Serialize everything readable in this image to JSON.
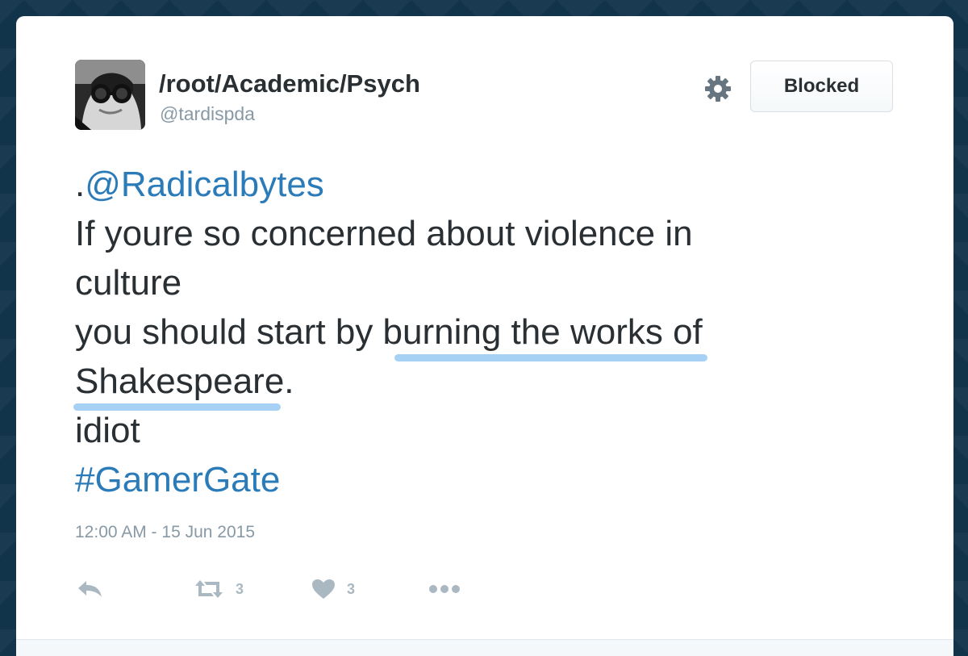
{
  "user": {
    "display_name": "/root/Academic/Psych",
    "handle": "@tardispda",
    "avatar": "avatar-photo"
  },
  "follow_button": {
    "label": "Blocked"
  },
  "tweet": {
    "prefix": ".",
    "mention": "@Radicalbytes",
    "line2": "If youre so concerned about violence in",
    "line3": "culture",
    "line4_before": "you should start by ",
    "line4_highlight": "burning the works of",
    "line5_highlight": "Shakespeare",
    "line5_after": ".",
    "line6": "idiot",
    "hashtag": "#GamerGate"
  },
  "timestamp": "12:00 AM - 15 Jun 2015",
  "actions": {
    "reply_icon": "reply-icon",
    "retweet_icon": "retweet-icon",
    "retweet_count": "3",
    "like_icon": "heart-icon",
    "like_count": "3",
    "more_icon": "more-icon"
  },
  "colors": {
    "link": "#2b7bb9",
    "highlight": "#a7d0f5",
    "muted": "#8899a6",
    "text": "#292f33"
  }
}
